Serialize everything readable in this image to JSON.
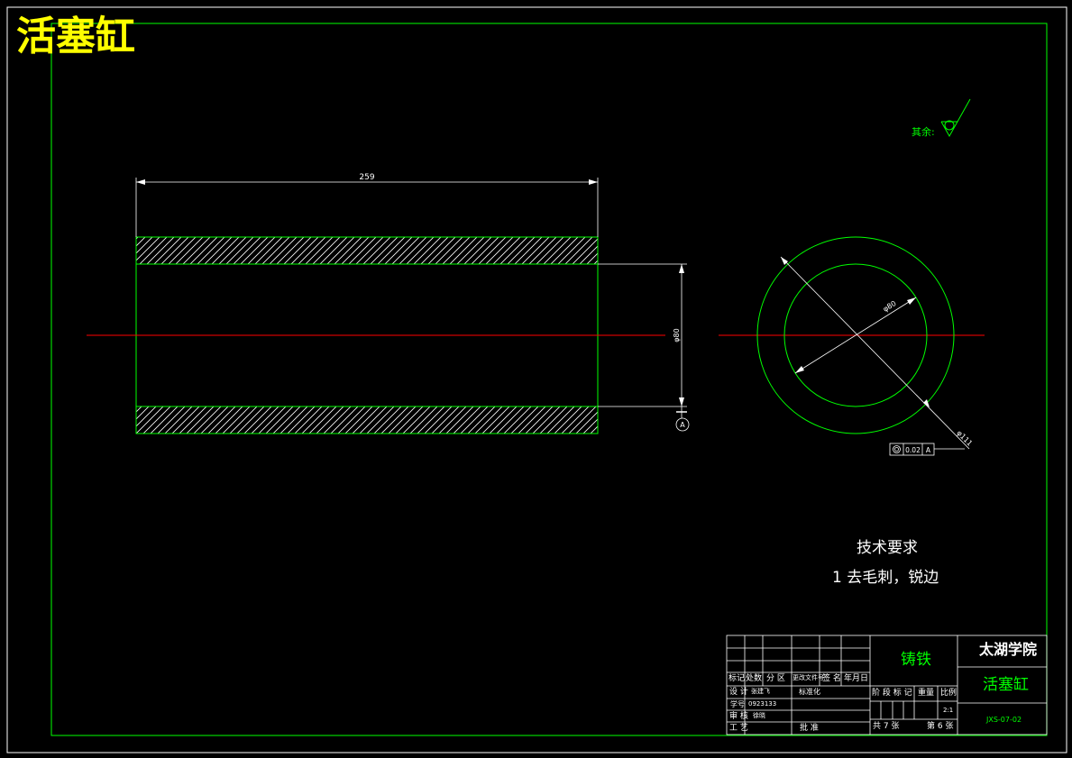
{
  "drawing": {
    "title_banner": "活塞缸",
    "dims": {
      "length": "259",
      "inner_diameter_side": "φ80",
      "inner_diameter_end": "φ80",
      "outer_diameter_end": "φ111",
      "datum": "A",
      "tolerance_value": "0.02",
      "tolerance_datum": "A"
    },
    "surface_note": "其余:",
    "tech_req": {
      "heading": "技术要求",
      "item1": "1 去毛刺，锐边"
    },
    "title_block": {
      "material": "铸铁",
      "school": "太湖学院",
      "part_name": "活塞缸",
      "drawing_no": "JXS-07-02",
      "hdr_mark": "标记",
      "hdr_count": "处数",
      "hdr_zone": "分 区",
      "hdr_changeno": "更改文件号",
      "hdr_sign": "签 名",
      "hdr_date": "年月日",
      "design_label": "设 计",
      "designer": "张建飞",
      "std_label": "标准化",
      "id_label": "学号",
      "student_id": "0923133",
      "check_label": "审 核",
      "checker": "徐晓",
      "process_label": "工 艺",
      "approve_label": "批 准",
      "stage_label": "阶 段 标 记",
      "weight_label": "重量",
      "scale_label": "比例",
      "scale": "2:1",
      "sheets_total": "共 7 张",
      "sheet_no": "第 6 张"
    }
  }
}
